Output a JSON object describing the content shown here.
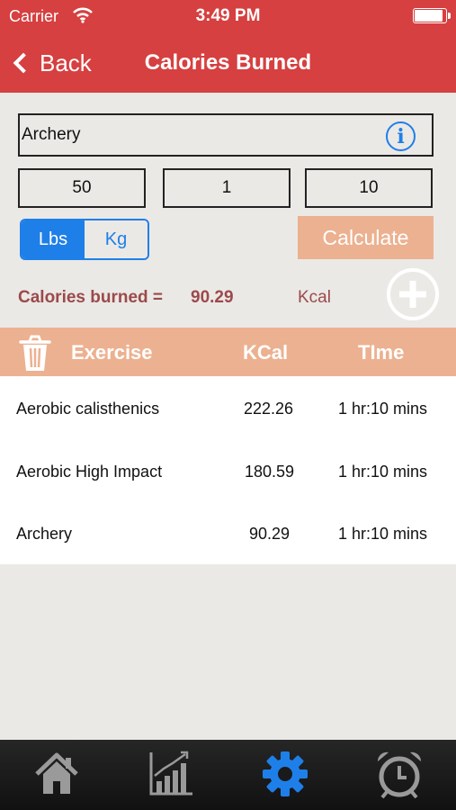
{
  "status": {
    "carrier": "Carrier",
    "time": "3:49 PM"
  },
  "nav": {
    "back_label": "Back",
    "title": "Calories Burned"
  },
  "form": {
    "exercise_value": "Archery",
    "input1": "50",
    "input2": "1",
    "input3": "10",
    "unit_lbs": "Lbs",
    "unit_kg": "Kg",
    "calculate_label": "Calculate"
  },
  "result": {
    "label": "Calories burned =",
    "value": "90.29",
    "unit": "Kcal"
  },
  "table": {
    "headers": {
      "exercise": "Exercise",
      "kcal": "KCal",
      "time": "TIme"
    },
    "rows": [
      {
        "exercise": "Aerobic calisthenics",
        "kcal": "222.26",
        "time": "1 hr:10 mins"
      },
      {
        "exercise": "Aerobic High Impact",
        "kcal": "180.59",
        "time": "1 hr:10 mins"
      },
      {
        "exercise": "Archery",
        "kcal": "90.29",
        "time": "1 hr:10 mins"
      }
    ]
  },
  "colors": {
    "header": "#d64040",
    "accent": "#1f7fe8",
    "peach": "#ecb190",
    "result_text": "#9b4a4a"
  },
  "tabs": [
    "home-icon",
    "chart-icon",
    "gear-icon",
    "alarm-clock-icon"
  ]
}
